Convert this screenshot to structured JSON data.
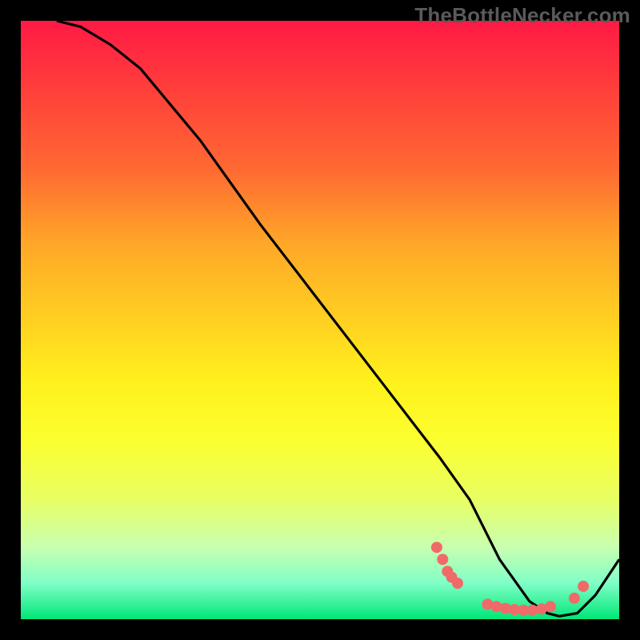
{
  "watermark": "TheBottleNecker.com",
  "chart_data": {
    "type": "line",
    "title": "",
    "xlabel": "",
    "ylabel": "",
    "xlim": [
      0,
      100
    ],
    "ylim": [
      0,
      100
    ],
    "grid": false,
    "series": [
      {
        "name": "curve",
        "x": [
          6,
          10,
          15,
          20,
          30,
          40,
          50,
          60,
          70,
          75,
          80,
          85,
          88,
          90,
          93,
          96,
          100
        ],
        "y": [
          100,
          99,
          96,
          92,
          80,
          66,
          53,
          40,
          27,
          20,
          10,
          3,
          1,
          0.5,
          1,
          4,
          10
        ]
      }
    ],
    "markers": {
      "name": "beads",
      "points": [
        {
          "x": 69.5,
          "y": 12
        },
        {
          "x": 70.5,
          "y": 10
        },
        {
          "x": 71.3,
          "y": 8
        },
        {
          "x": 72.0,
          "y": 7
        },
        {
          "x": 73.0,
          "y": 6
        },
        {
          "x": 78.0,
          "y": 2.5
        },
        {
          "x": 79.5,
          "y": 2.1
        },
        {
          "x": 81.0,
          "y": 1.8
        },
        {
          "x": 82.5,
          "y": 1.6
        },
        {
          "x": 84.0,
          "y": 1.5
        },
        {
          "x": 85.5,
          "y": 1.5
        },
        {
          "x": 87.0,
          "y": 1.7
        },
        {
          "x": 88.5,
          "y": 2.1
        },
        {
          "x": 92.5,
          "y": 3.5
        },
        {
          "x": 94.0,
          "y": 5.5
        }
      ]
    },
    "colors": {
      "curve": "#000000",
      "markers": "#f06a6a"
    }
  }
}
